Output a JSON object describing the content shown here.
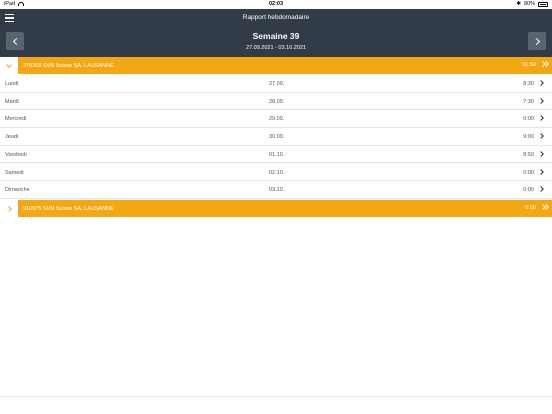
{
  "status_bar": {
    "device": "iPad",
    "time": "02:03",
    "battery": "80%"
  },
  "header": {
    "title": "Rapport hebdomadaire",
    "week_label": "Semaine 39",
    "date_range": "27.09.2021 - 03.10.2021"
  },
  "groups": [
    {
      "label": "275368 SVN Suisse SA, LAUSANNE",
      "total": "01:50",
      "expanded": true
    },
    {
      "label": "910975 SVN Suisse SA, LAUSANNE",
      "total": "0:00",
      "expanded": false
    }
  ],
  "days": [
    {
      "day": "Lundi",
      "date": "27.09.",
      "hours": "8:30"
    },
    {
      "day": "Mardi",
      "date": "28.09.",
      "hours": "7:30"
    },
    {
      "day": "Mercredi",
      "date": "29.09.",
      "hours": "0:00"
    },
    {
      "day": "Jeudi",
      "date": "30.09.",
      "hours": "9:00"
    },
    {
      "day": "Vendredi",
      "date": "01.10.",
      "hours": "8:50"
    },
    {
      "day": "Samedi",
      "date": "02.10.",
      "hours": "0:00"
    },
    {
      "day": "Dimanche",
      "date": "03.10.",
      "hours": "0:00"
    }
  ],
  "colors": {
    "header_bg": "#323c48",
    "accent": "#f3a712"
  },
  "icons": [
    "menu-icon",
    "chevron-left-icon",
    "chevron-right-icon",
    "chevron-down-icon",
    "double-chevron-right-icon"
  ]
}
